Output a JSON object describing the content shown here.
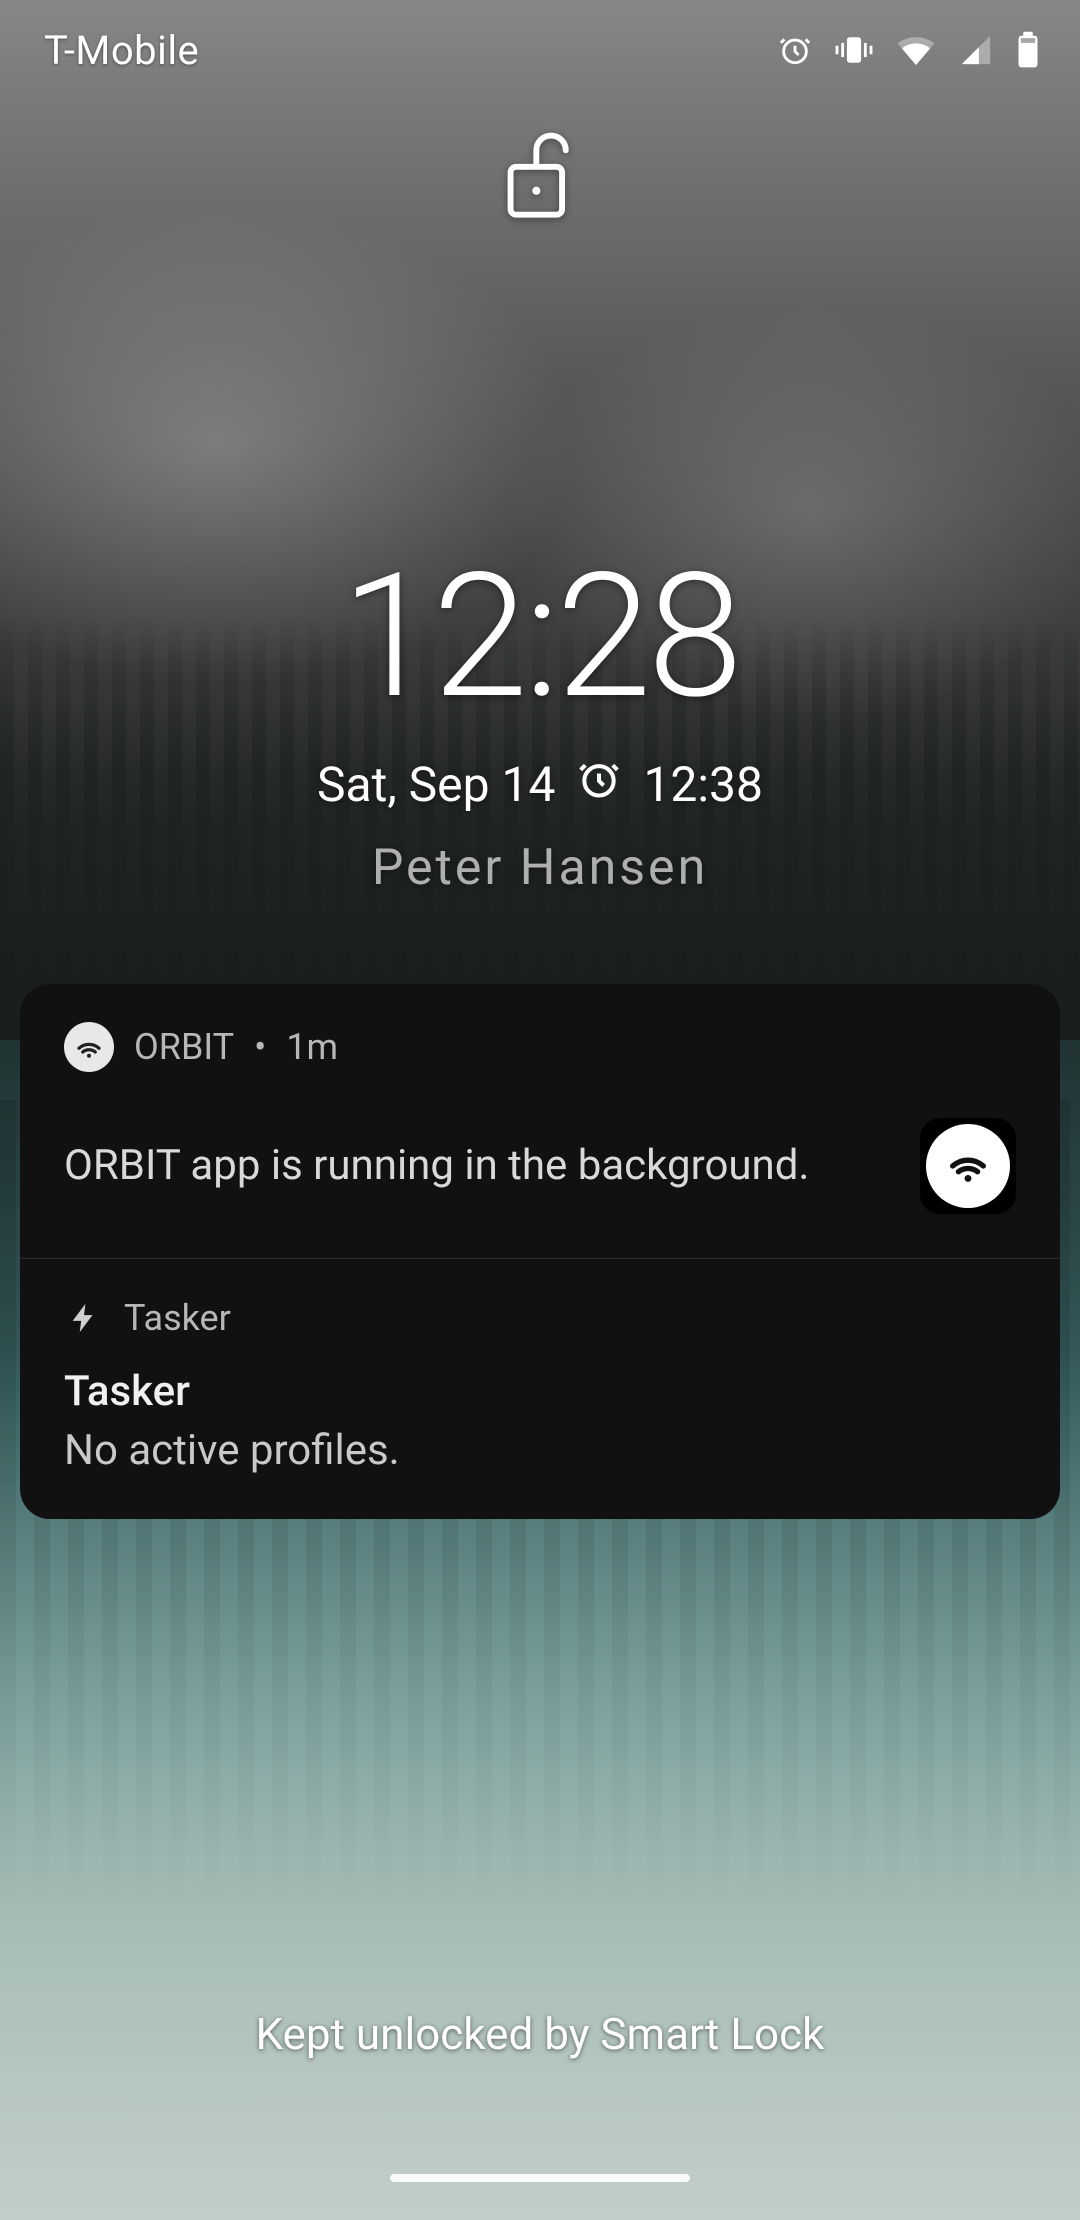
{
  "status_bar": {
    "carrier": "T-Mobile",
    "icons": {
      "alarm": "alarm-icon",
      "vibrate": "vibrate-icon",
      "wifi": "wifi-icon",
      "signal": "signal-icon",
      "battery": "battery-icon"
    }
  },
  "lock": {
    "state": "unlocked",
    "time": "12:28",
    "date": "Sat, Sep 14",
    "alarm_time": "12:38",
    "owner": "Peter Hansen",
    "footer": "Kept unlocked by Smart Lock"
  },
  "notifications": [
    {
      "app": "ORBIT",
      "age": "1m",
      "body": "ORBIT app is running in the background.",
      "icon": "wifi-beacon-icon"
    },
    {
      "app": "Tasker",
      "title": "Tasker",
      "body": "No active profiles.",
      "icon": "bolt-icon"
    }
  ]
}
